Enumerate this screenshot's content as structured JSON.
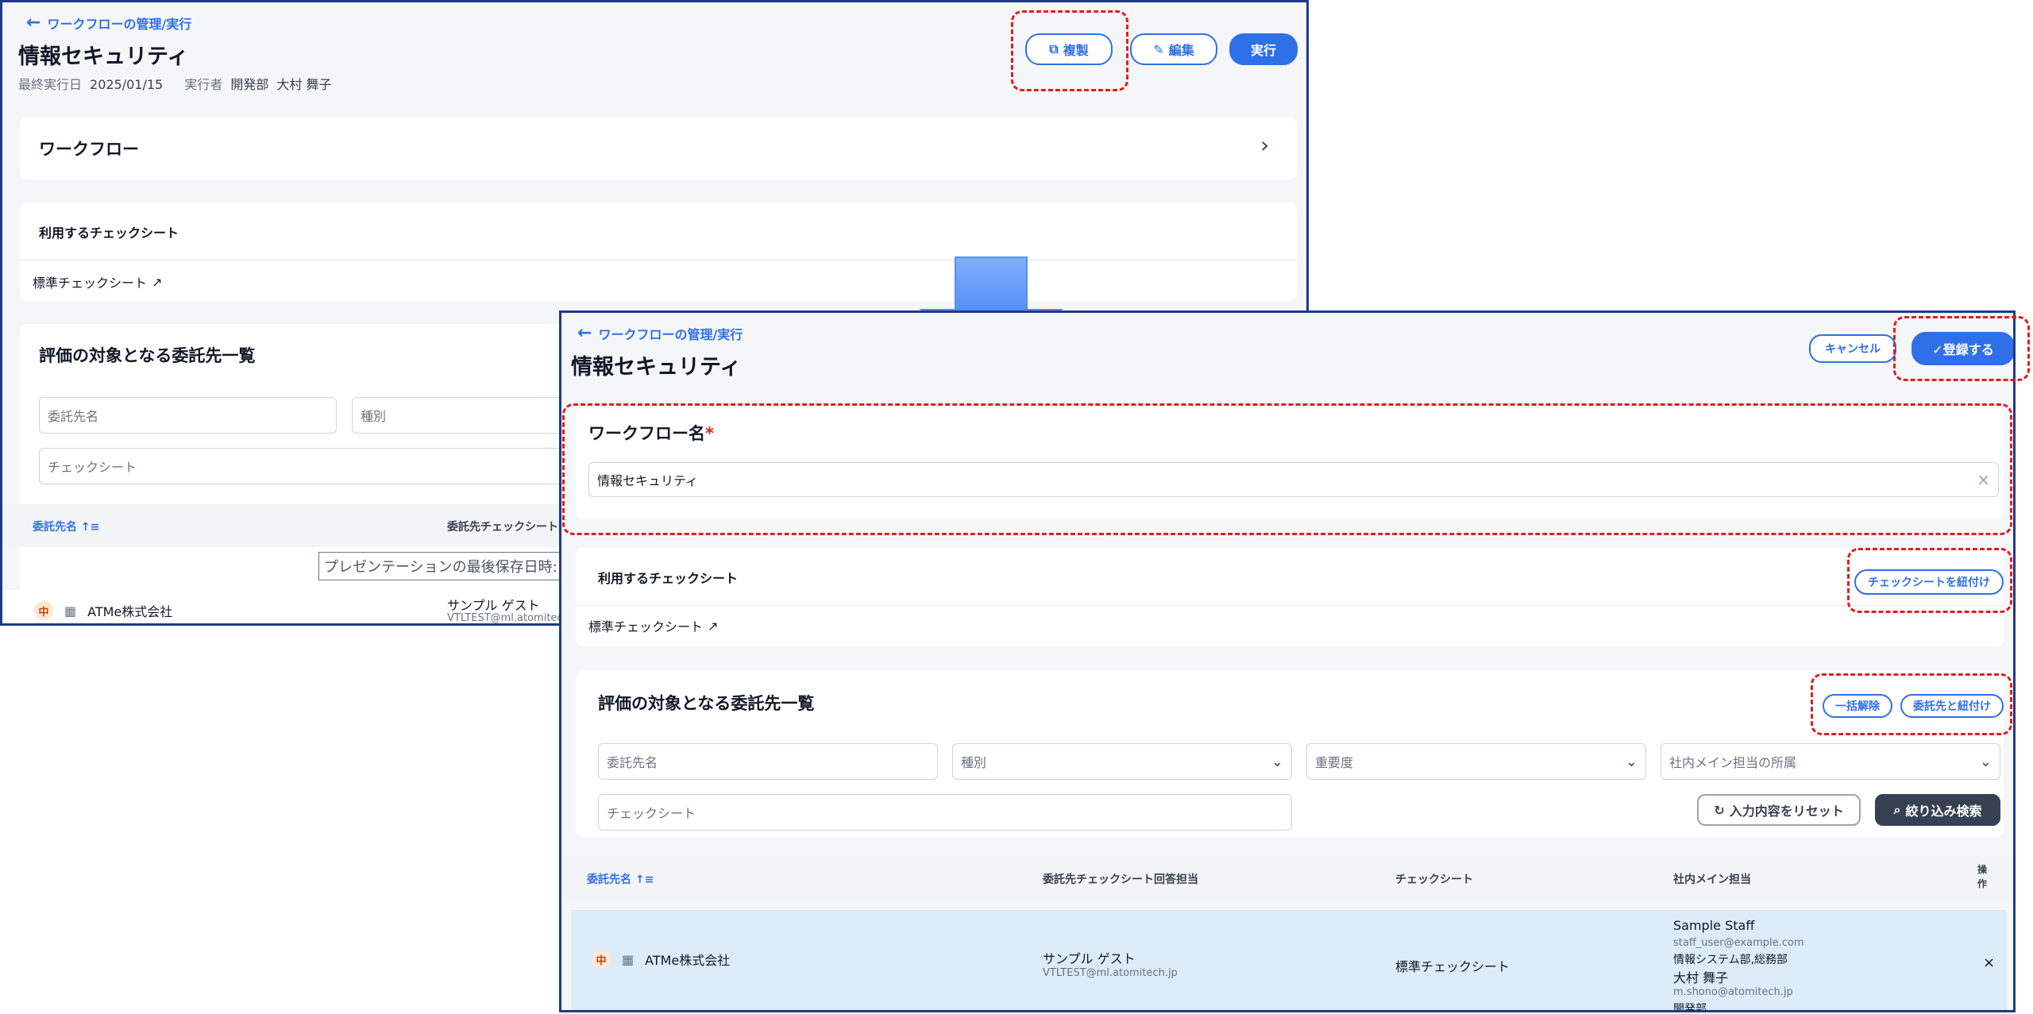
{
  "before": {
    "back_link": "ワークフローの管理/実行",
    "title": "情報セキュリティ",
    "meta": {
      "last_run_label": "最終実行日",
      "last_run_value": "2025/01/15",
      "runner_label": "実行者",
      "runner_dept": "開発部",
      "runner_name": "大村 舞子"
    },
    "buttons": {
      "duplicate": "複製",
      "edit": "編集",
      "run": "実行"
    },
    "workflow_section": "ワークフロー",
    "checksheet_section": "利用するチェックシート",
    "checksheet_item": "標準チェックシート",
    "vendor_section": "評価の対象となる委託先一覧",
    "filters": {
      "vendor_name": "委託先名",
      "type": "種別",
      "checksheet": "チェックシート"
    },
    "table_headers": {
      "vendor_name": "委託先名",
      "respondent": "委託先チェックシート回答担当"
    },
    "tooltip": "プレゼンテーションの最後保存日時: たった",
    "row": {
      "priority": "中",
      "company": "ATMe株式会社",
      "respondent_name": "サンプル ゲスト",
      "respondent_email": "VTLTEST@ml.atomitech"
    }
  },
  "after": {
    "back_link": "ワークフローの管理/実行",
    "title": "情報セキュリティ",
    "buttons": {
      "cancel": "キャンセル",
      "register": "✓登録する"
    },
    "workflow_name_label": "ワークフロー名",
    "required_mark": "*",
    "workflow_name_value": "情報セキュリティ",
    "checksheet_section": "利用するチェックシート",
    "link_checksheet_button": "チェックシートを紐付け",
    "checksheet_item": "標準チェックシート",
    "vendor_section": "評価の対象となる委託先一覧",
    "bulk_release_button": "一括解除",
    "link_vendor_button": "委託先と紐付け",
    "filters": {
      "vendor_name": "委託先名",
      "type": "種別",
      "importance": "重要度",
      "affiliation": "社内メイン担当の所属",
      "checksheet": "チェックシート"
    },
    "reset_button": "入力内容をリセット",
    "search_button": "絞り込み検索",
    "table_headers": {
      "vendor_name": "委託先名",
      "respondent": "委託先チェックシート回答担当",
      "checksheet": "チェックシート",
      "internal_main": "社内メイン担当",
      "ops_1": "操",
      "ops_2": "作"
    },
    "row": {
      "priority": "中",
      "company": "ATMe株式会社",
      "respondent_name": "サンプル ゲスト",
      "respondent_email": "VTLTEST@ml.atomitech.jp",
      "checksheet": "標準チェックシート",
      "staff1_name": "Sample Staff",
      "staff1_email": "staff_user@example.com",
      "staff1_dept": "情報システム部,総務部",
      "staff2_name": "大村 舞子",
      "staff2_email": "m.shono@atomitech.jp",
      "staff2_dept": "開発部",
      "remove": "×"
    }
  },
  "colors": {
    "accent": "#2f6fe8",
    "highlight": "#e11d1d",
    "frame": "#1e3a8a",
    "arrow": "#3b82f6"
  }
}
